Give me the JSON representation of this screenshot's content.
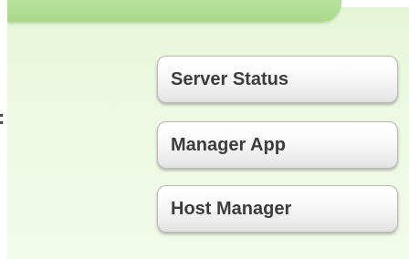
{
  "buttons": {
    "server_status": "Server Status",
    "manager_app": "Manager App",
    "host_manager": "Host Manager"
  },
  "left_fragment": {
    "glyph": ":"
  }
}
